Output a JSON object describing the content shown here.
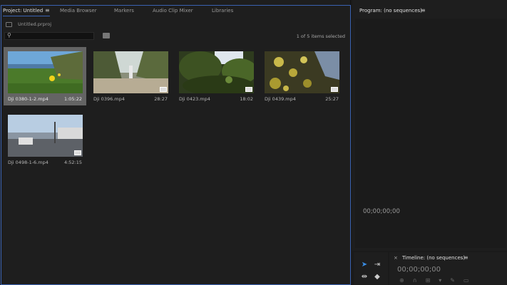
{
  "project_panel": {
    "tabs": [
      {
        "label": "Project: Untitled",
        "active": true
      },
      {
        "label": "Media Browser"
      },
      {
        "label": "Markers"
      },
      {
        "label": "Audio Clip Mixer"
      },
      {
        "label": "Libraries"
      }
    ],
    "menu_icon": "≡",
    "project_file": "Untitled.prproj",
    "search_placeholder": "",
    "selection_count": "1 of 5 items selected",
    "clips": [
      {
        "name": "Dji 0380-1-2.mp4",
        "duration": "1:05:22",
        "selected": true
      },
      {
        "name": "Dji 0396.mp4",
        "duration": "28:27"
      },
      {
        "name": "Dji 0423.mp4",
        "duration": "18:02"
      },
      {
        "name": "Dji 0439.mp4",
        "duration": "25:27"
      },
      {
        "name": "Dji 0498-1-6.mp4",
        "duration": "4:52:15"
      }
    ]
  },
  "program_monitor": {
    "title": "Program: (no sequences)",
    "menu_icon": "≡",
    "timecode": "00;00;00;00"
  },
  "timeline": {
    "close": "×",
    "title": "Timeline: (no sequences)",
    "menu_icon": "≡",
    "timecode": "00;00;00;00"
  },
  "colors": {
    "accent": "#3a62b2",
    "panel_bg": "#1e1e1e",
    "selected_card": "#646464"
  }
}
